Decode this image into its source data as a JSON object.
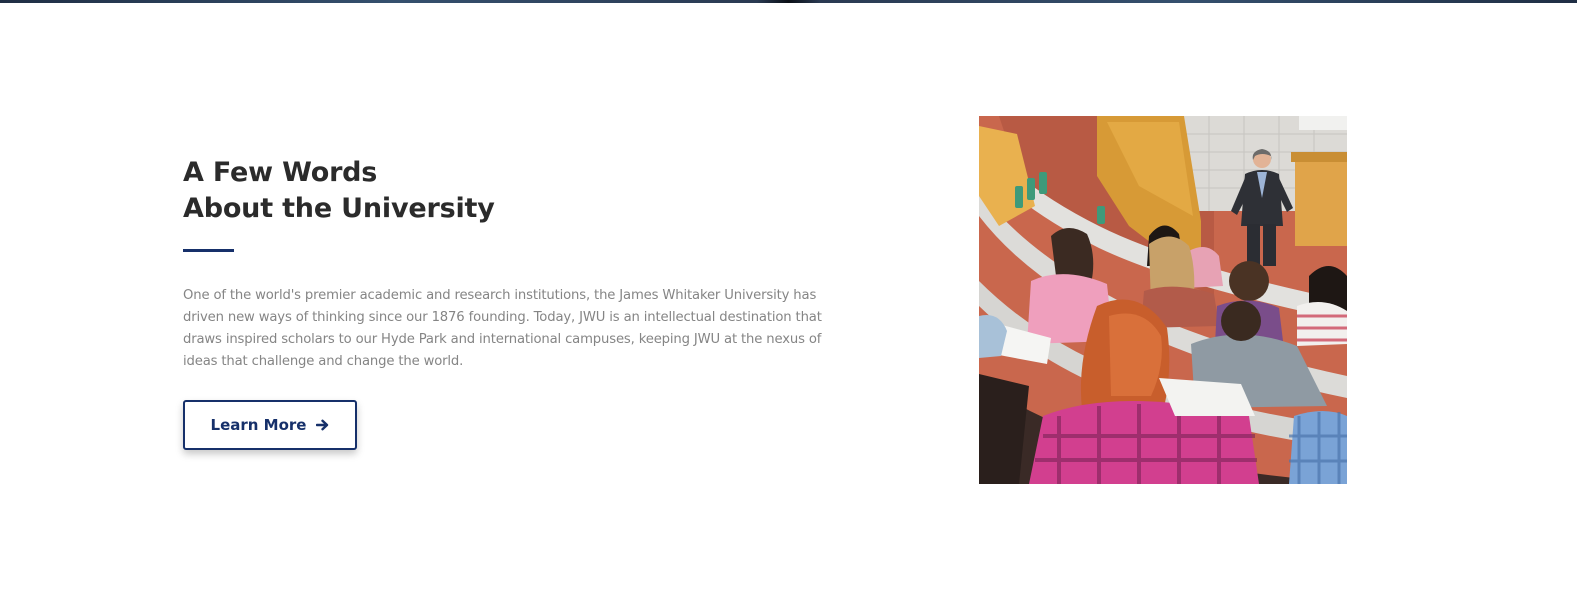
{
  "about": {
    "heading_line1": "A Few Words",
    "heading_line2": "About the University",
    "description": "One of the world's premier academic and research institutions, the James Whitaker University has driven new ways of thinking since our 1876 founding. Today, JWU is an intellectual destination that draws inspired scholars to our Hyde Park and international campuses, keeping JWU at the nexus of ideas that challenge and change the world.",
    "button_label": "Learn More",
    "button_icon": "arrow-right-icon"
  },
  "colors": {
    "accent": "#16306a",
    "heading": "#2b2b2b",
    "body_text": "#858585"
  }
}
